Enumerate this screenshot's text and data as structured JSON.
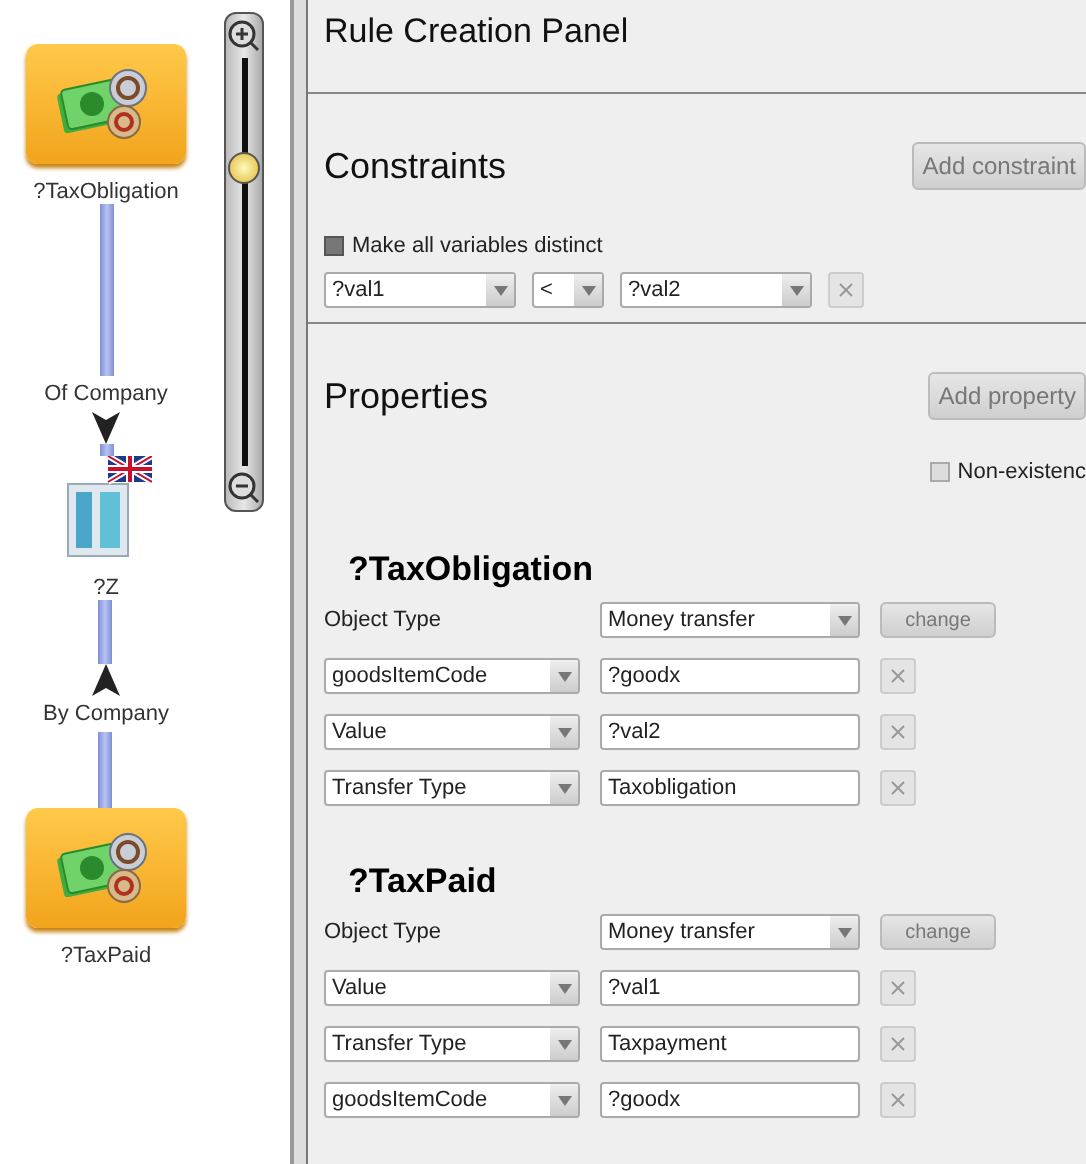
{
  "graph": {
    "nodes": [
      {
        "kind": "money",
        "label": "?TaxObligation"
      },
      {
        "kind": "company",
        "label": "?Z"
      },
      {
        "kind": "money",
        "label": "?TaxPaid"
      }
    ],
    "edges": [
      {
        "label": "Of Company",
        "kind": "down"
      },
      {
        "label": "By Company",
        "kind": "up"
      }
    ]
  },
  "zoom_slider": {
    "level": 0.73
  },
  "rule_panel": {
    "title": "Rule Creation Panel"
  },
  "constraints": {
    "heading": "Constraints",
    "add_button": "Add constraint",
    "distinct": {
      "label": "Make all variables distinct",
      "checked": true
    },
    "rows": [
      {
        "left": "?val1",
        "operator": "<",
        "right": "?val2"
      }
    ]
  },
  "properties": {
    "heading": "Properties",
    "add_button": "Add property",
    "non_existence": {
      "label": "Non-existenc",
      "checked": false
    },
    "objects": [
      {
        "name": "?TaxObligation",
        "type_label": "Object Type",
        "type": "Money transfer",
        "change_button": "change",
        "properties": [
          {
            "name": "goodsItemCode",
            "value": "?goodx"
          },
          {
            "name": "Value",
            "value": "?val2"
          },
          {
            "name": "Transfer Type",
            "value": "Taxobligation"
          }
        ]
      },
      {
        "name": "?TaxPaid",
        "type_label": "Object Type",
        "type": "Money transfer",
        "change_button": "change",
        "properties": [
          {
            "name": "Value",
            "value": "?val1"
          },
          {
            "name": "Transfer Type",
            "value": "Taxpayment"
          },
          {
            "name": "goodsItemCode",
            "value": "?goodx"
          }
        ]
      }
    ]
  }
}
